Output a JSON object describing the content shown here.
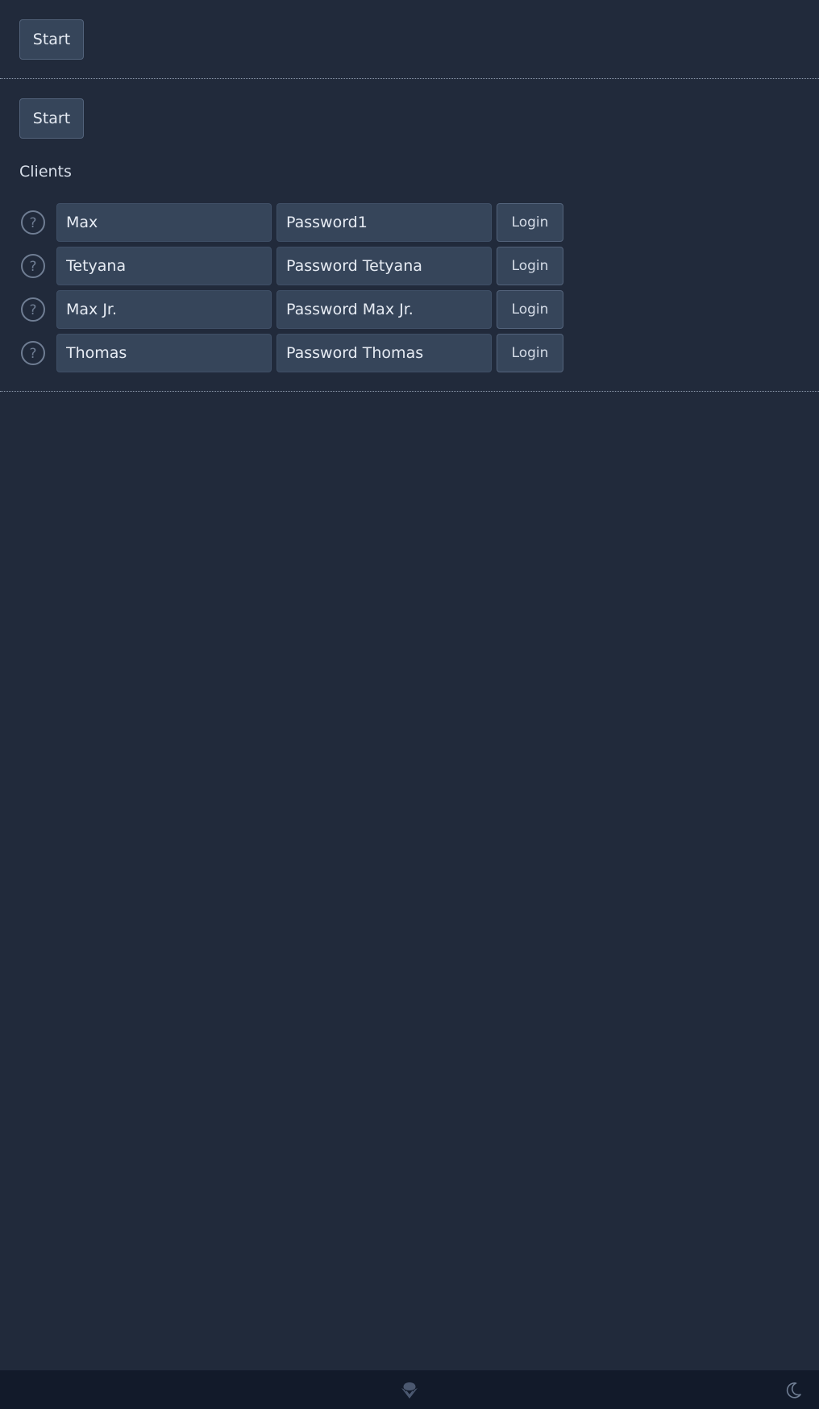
{
  "top_section": {
    "start_label": "Start"
  },
  "clients_section": {
    "start_label": "Start",
    "heading": "Clients",
    "clients": [
      {
        "name": "Max",
        "password": "Password1",
        "login_label": "Login"
      },
      {
        "name": "Tetyana",
        "password": "Password Tetyana",
        "login_label": "Login"
      },
      {
        "name": "Max Jr.",
        "password": "Password Max Jr.",
        "login_label": "Login"
      },
      {
        "name": "Thomas",
        "password": "Password Thomas",
        "login_label": "Login"
      }
    ]
  },
  "footer": {
    "logo_icon": "spade-logo-icon",
    "theme_icon": "moon-icon"
  },
  "colors": {
    "background": "#212a3b",
    "field_background": "#36455a",
    "footer_background": "#121a2a",
    "text": "#d6dde8"
  }
}
